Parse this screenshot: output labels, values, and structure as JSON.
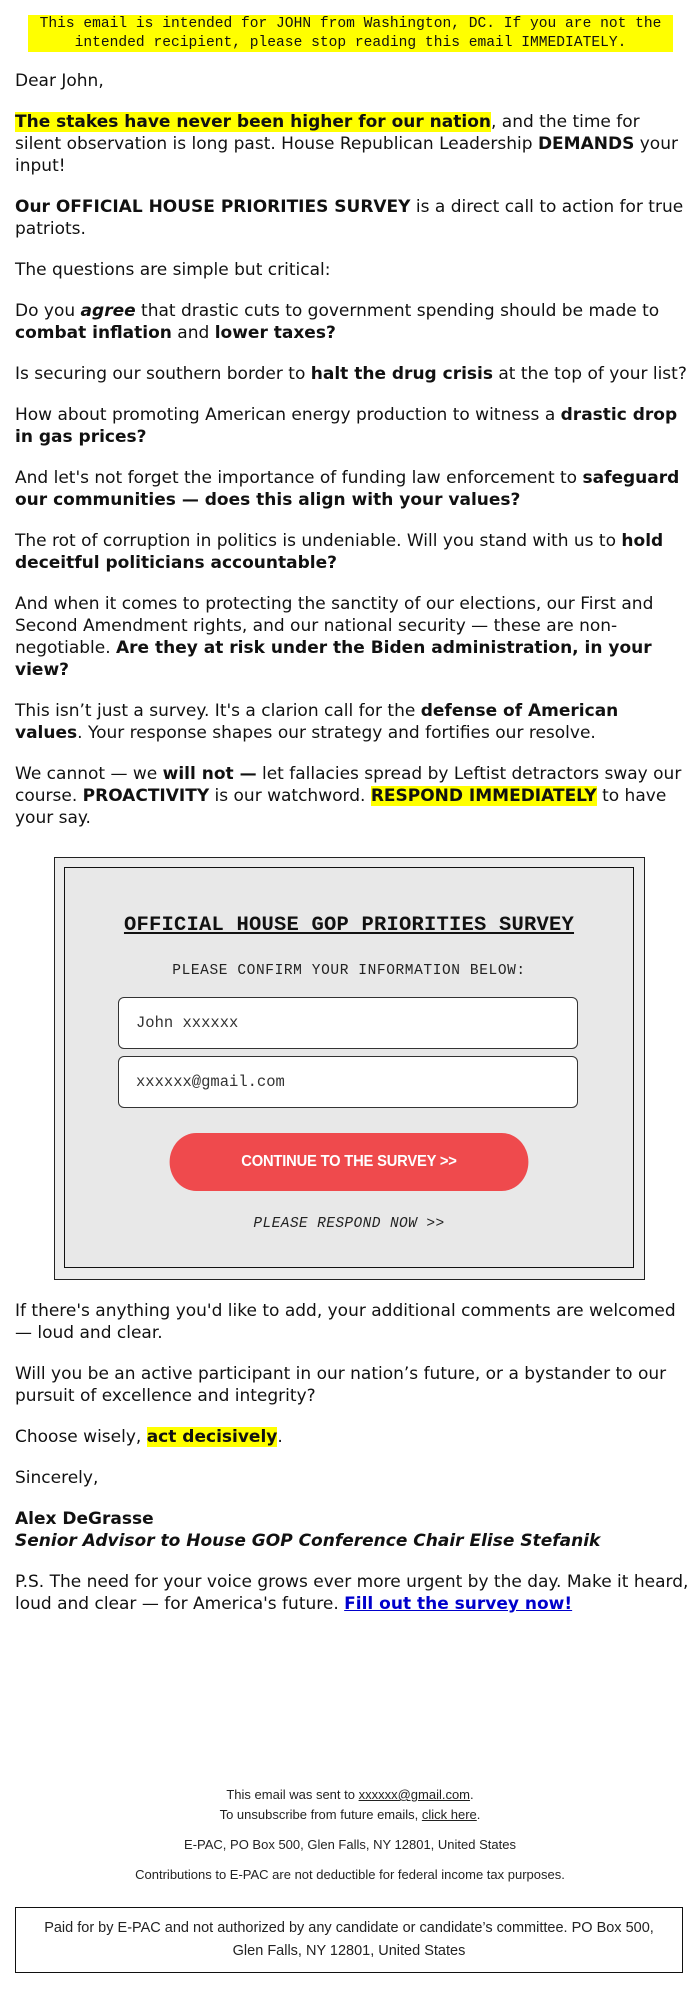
{
  "banner": {
    "text": "This email is intended for JOHN from Washington, DC. If you are not the intended recipient, please stop reading this email IMMEDIATELY.",
    "highlight_color": "#ffff00"
  },
  "greeting": "Dear John,",
  "paragraphs": {
    "p1": {
      "hl": "The stakes have never been higher for our nation",
      "t1": ", and the time for silent observation is long past. House Republican Leadership ",
      "b1": "DEMANDS",
      "t2": " your input!"
    },
    "p2": {
      "b1": "Our OFFICIAL HOUSE PRIORITIES SURVEY",
      "t1": " is a direct call to action for true patriots."
    },
    "p3": "The questions are simple but critical:",
    "p4": {
      "t1": "Do you ",
      "bi1": "agree",
      "t2": " that drastic cuts to government spending should be made to ",
      "b1": "combat inflation",
      "t3": " and ",
      "b2": "lower taxes?"
    },
    "p5": {
      "t1": "Is securing our southern border to ",
      "b1": "halt the drug crisis",
      "t2": " at the top of your list?"
    },
    "p6": {
      "t1": "How about promoting American energy production to witness a ",
      "b1": "drastic drop in gas prices?"
    },
    "p7": {
      "t1": "And let's not forget the importance of funding law enforcement to ",
      "b1": "safeguard our communities — does this align with your values?"
    },
    "p8": {
      "t1": "The rot of corruption in politics is undeniable. Will you stand with us to ",
      "b1": "hold deceitful politicians accountable?"
    },
    "p9": {
      "t1": "And when it comes to protecting the sanctity of our elections, our First and Second Amendment rights, and our national security — these are non-negotiable. ",
      "b1": "Are they at risk under the Biden administration, in your view?"
    },
    "p10": {
      "t1": "This isn’t just a survey. It's a clarion call for the ",
      "b1": "defense of American values",
      "t2": ". Your response shapes our strategy and fortifies our resolve."
    },
    "p11": {
      "t1": "We cannot — we ",
      "b1": "will not —",
      "t2": " let fallacies spread by Leftist detractors sway our course. ",
      "b2": "PROACTIVITY",
      "t3": " is our watchword. ",
      "hl": "RESPOND IMMEDIATELY",
      "t4": " to have your say."
    }
  },
  "survey": {
    "title": "OFFICIAL HOUSE GOP PRIORITIES SURVEY",
    "subtitle": "PLEASE CONFIRM YOUR INFORMATION BELOW:",
    "name_value": "John xxxxxx",
    "email_value": "xxxxxx@gmail.com",
    "button_label": "CONTINUE TO THE SURVEY >>",
    "button_color": "#ef4a4d",
    "respond_now": "PLEASE RESPOND NOW >>"
  },
  "closing": {
    "p12": "If there's anything you'd like to add, your additional comments are welcomed — loud and clear.",
    "p13": "Will you be an active participant in our nation’s future, or a bystander to our pursuit of excellence and integrity?",
    "p14_t1": "Choose wisely, ",
    "p14_hl": "act decisively",
    "p14_t2": ".",
    "signoff": "Sincerely,",
    "signer_name": "Alex DeGrasse",
    "signer_title": "Senior Advisor to House GOP Conference Chair Elise Stefanik",
    "ps_text": "P.S. The need for your voice grows ever more urgent by the day. Make it heard, loud and clear — for America's future. ",
    "ps_link": "Fill out the survey now!",
    "link_color": "#0000cc"
  },
  "footer": {
    "sent_to_prefix": "This email was sent to ",
    "sent_to_email": "xxxxxx@gmail.com",
    "sent_to_suffix": ".",
    "unsub_prefix": "To unsubscribe from future emails, ",
    "unsub_link": "click here",
    "unsub_suffix": ".",
    "address": "E-PAC, PO Box 500, Glen Falls, NY 12801, United States",
    "tax_notice": "Contributions to E-PAC are not deductible for federal income tax purposes.",
    "disclaimer": "Paid for by E-PAC and not authorized by any candidate or candidate’s committee. PO Box 500, Glen Falls, NY 12801, United States"
  }
}
